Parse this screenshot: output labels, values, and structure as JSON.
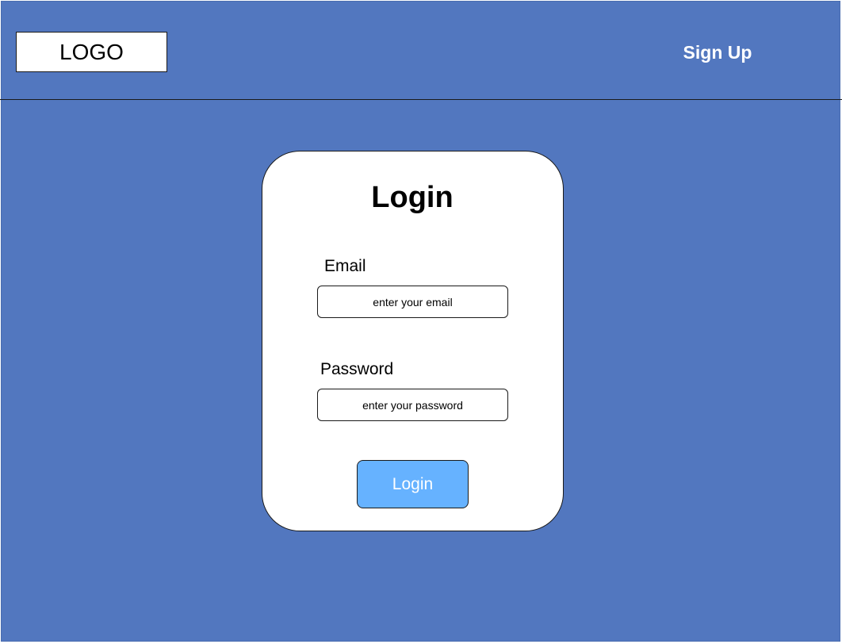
{
  "header": {
    "logo_text": "LOGO",
    "signup_label": "Sign Up"
  },
  "login_card": {
    "title": "Login",
    "email": {
      "label": "Email",
      "placeholder": "enter your email"
    },
    "password": {
      "label": "Password",
      "placeholder": "enter your password"
    },
    "submit_label": "Login"
  },
  "colors": {
    "background": "#5277bf",
    "card": "#ffffff",
    "button": "#66b2ff",
    "header_text": "#ffffff"
  }
}
